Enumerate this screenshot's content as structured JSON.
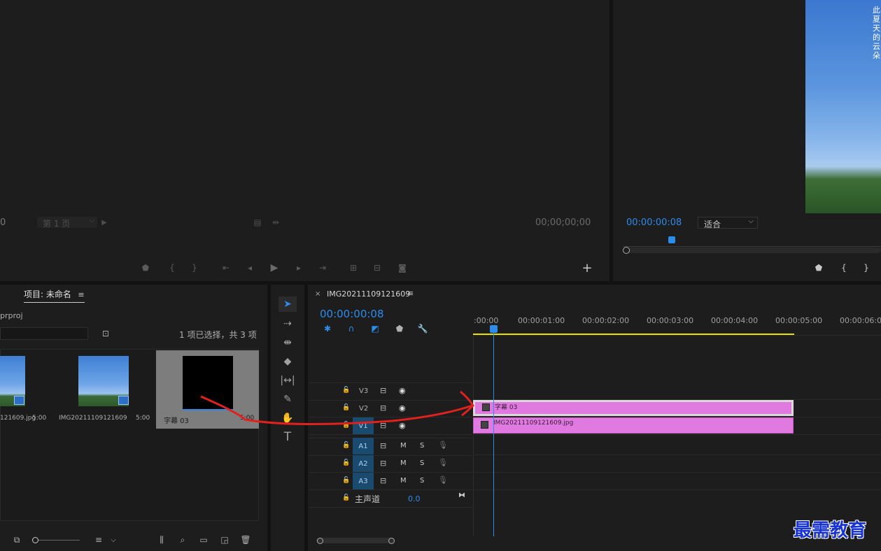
{
  "source_monitor": {
    "left_value": "0",
    "page_select": "第 1 页",
    "timecode": "00;00;00;00"
  },
  "program_monitor": {
    "timecode": "00:00:00:08",
    "fit_select": "适合",
    "overlay_text": "此夏天的云朵"
  },
  "project_panel": {
    "tab_title": "项目: 未命名",
    "file_name": "prproj",
    "selection_status": "1 项已选择，共 3 项",
    "items": [
      {
        "name": "121609.jpg",
        "duration": "5:00"
      },
      {
        "name": "IMG20211109121609",
        "duration": "5:00"
      },
      {
        "name": "字幕 03",
        "duration": "5:00"
      }
    ]
  },
  "timeline": {
    "sequence_name": "IMG20211109121609",
    "timecode": "00:00:00:08",
    "ruler_labels": [
      ":00:00",
      "00:00:01:00",
      "00:00:02:00",
      "00:00:03:00",
      "00:00:04:00",
      "00:00:05:00",
      "00:00:06:00"
    ],
    "video_tracks": [
      "V3",
      "V2",
      "V1"
    ],
    "audio_tracks": [
      "A1",
      "A2",
      "A3"
    ],
    "master_label": "主声道",
    "master_value": "0.0",
    "mute_label": "M",
    "solo_label": "S",
    "clips": [
      {
        "track": "V2",
        "name": "字幕 03"
      },
      {
        "track": "V1",
        "name": "IMG20211109121609.jpg"
      }
    ]
  },
  "watermark": "最需教育",
  "colors": {
    "accent": "#2d8ceb",
    "clip": "#e07ae0",
    "annotation": "#e0211d",
    "work_area": "#e8e000"
  }
}
